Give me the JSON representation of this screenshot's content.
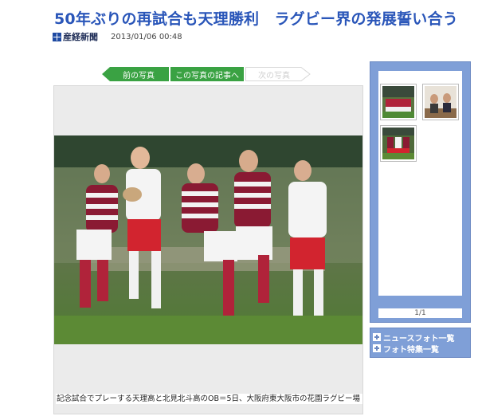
{
  "article": {
    "title": "50年ぶりの再試合も天理勝利　ラグビー界の発展誓い合う",
    "publisher": "産経新聞",
    "date": "2013/01/06 00:48"
  },
  "nav": {
    "prev_label": "前の写真",
    "article_label": "この写真の記事へ",
    "next_label": "次の写真"
  },
  "photo": {
    "caption": "記念試合でプレーする天理高と北見北斗高のOB＝5日、大阪府東大阪市の花園ラグビー場"
  },
  "sidebar": {
    "pager": "1/1",
    "links": [
      {
        "label": "ニュースフォト一覧"
      },
      {
        "label": "フォト特集一覧"
      }
    ]
  },
  "colors": {
    "title_blue": "#2a56b9",
    "nav_green": "#3aa243",
    "sidebar_blue": "#7f9fd7"
  }
}
